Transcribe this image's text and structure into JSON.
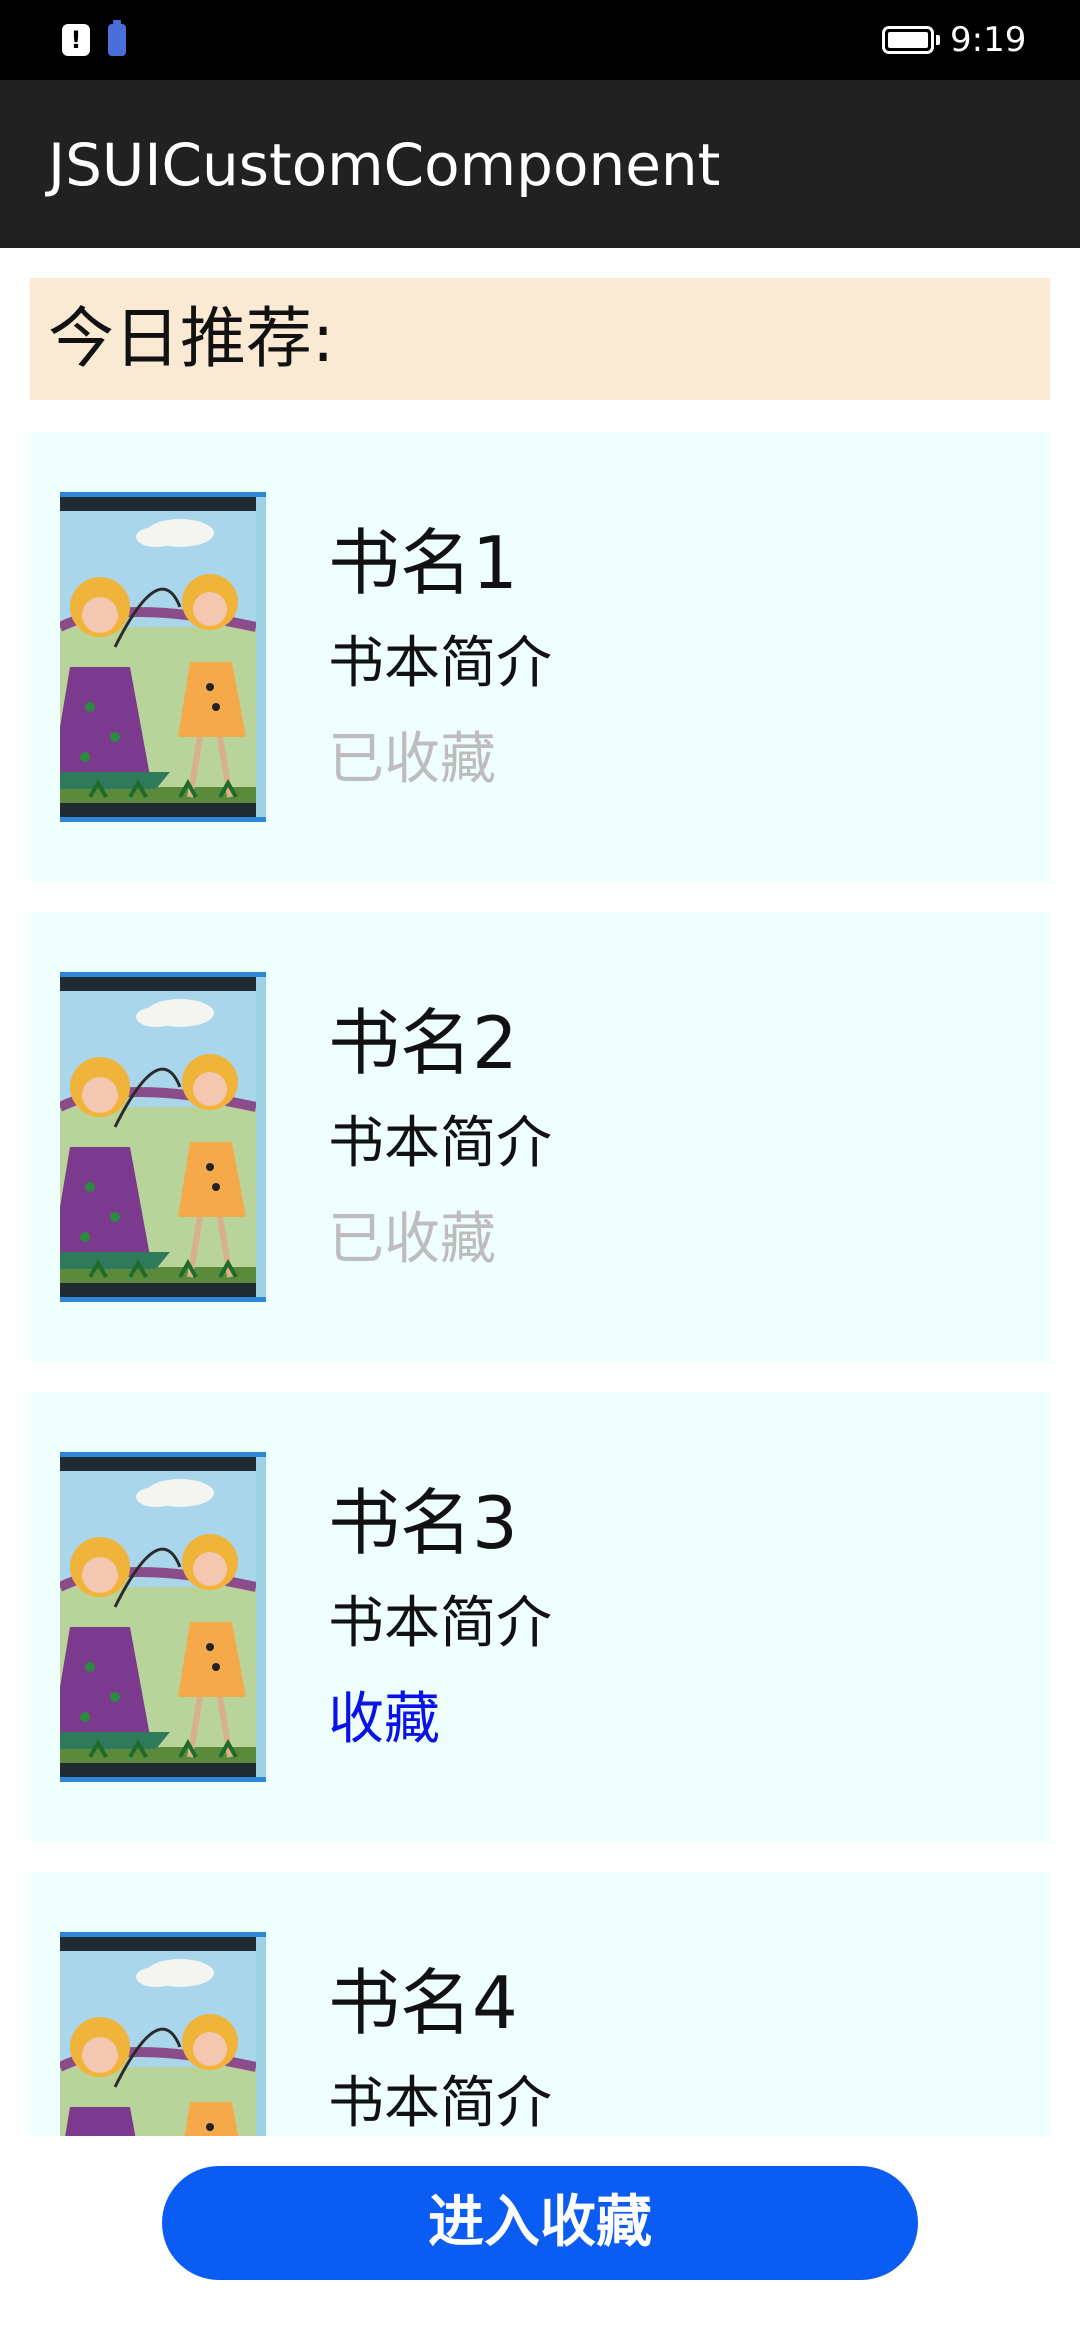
{
  "status_bar": {
    "alert_icon": "alert-icon",
    "battery_saver_icon": "battery-charging-icon",
    "battery_icon": "battery-icon",
    "time": "9:19"
  },
  "app_bar": {
    "title": "JSUICustomComponent"
  },
  "header": {
    "text": "今日推荐:"
  },
  "books": [
    {
      "title": "书名1",
      "desc": "书本简介",
      "status": "已收藏",
      "favored": true
    },
    {
      "title": "书名2",
      "desc": "书本简介",
      "status": "已收藏",
      "favored": true
    },
    {
      "title": "书名3",
      "desc": "书本简介",
      "status": "收藏",
      "favored": false
    },
    {
      "title": "书名4",
      "desc": "书本简介",
      "status": "",
      "favored": null
    }
  ],
  "colors": {
    "header_bg": "#fae9d3",
    "card_bg": "#effffe",
    "favored_text": "#bdbdbd",
    "favorite_link": "#0a12e6",
    "button_bg": "#0b5cf2",
    "app_bar_bg": "#212121"
  },
  "bottom_button": {
    "label": "进入收藏"
  }
}
